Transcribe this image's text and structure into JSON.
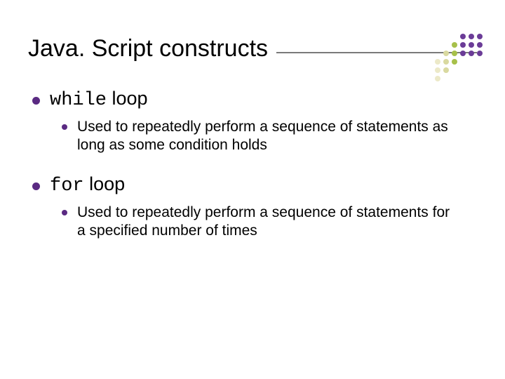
{
  "title": "Java. Script constructs",
  "items": [
    {
      "keyword": "while",
      "suffix": " loop",
      "sub": "Used to repeatedly perform a sequence of statements as long as some condition holds"
    },
    {
      "keyword": "for",
      "suffix": " loop",
      "sub": "Used to repeatedly perform a sequence of statements for a specified number of times"
    }
  ],
  "decor": {
    "dot_colors": [
      "transparent",
      "transparent",
      "transparent",
      "#6b3c97",
      "#6b3c97",
      "#6b3c97",
      "transparent",
      "transparent",
      "#a7c04a",
      "#6b3c97",
      "#6b3c97",
      "#6b3c97",
      "transparent",
      "#d9d9a0",
      "#a7c04a",
      "#6b3c97",
      "#6b3c97",
      "#6b3c97",
      "#ece9c8",
      "#d9d9a0",
      "#a7c04a",
      "transparent",
      "transparent",
      "transparent",
      "#ece9c8",
      "#d9d9a0",
      "transparent",
      "transparent",
      "transparent",
      "transparent",
      "#ece9c8",
      "transparent",
      "transparent",
      "transparent",
      "transparent",
      "transparent"
    ]
  }
}
